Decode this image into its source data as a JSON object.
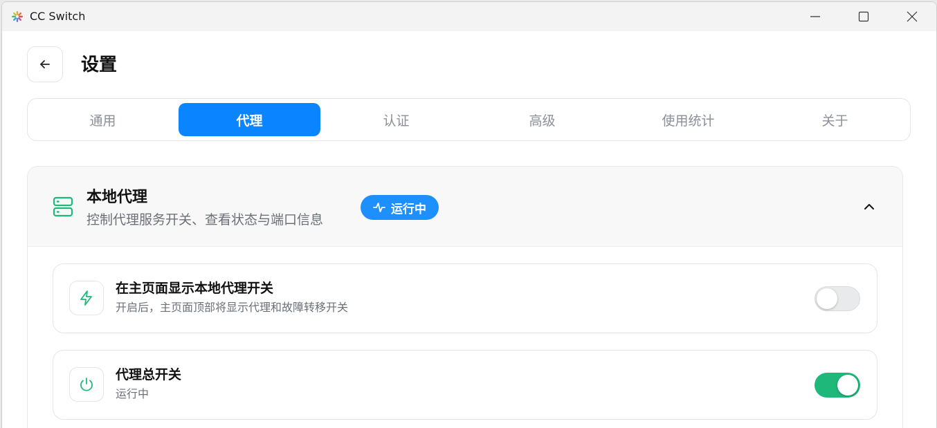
{
  "window": {
    "title": "CC Switch"
  },
  "header": {
    "page_title": "设置"
  },
  "tabs": [
    {
      "label": "通用",
      "active": false
    },
    {
      "label": "代理",
      "active": true
    },
    {
      "label": "认证",
      "active": false
    },
    {
      "label": "高级",
      "active": false
    },
    {
      "label": "使用统计",
      "active": false
    },
    {
      "label": "关于",
      "active": false
    }
  ],
  "section": {
    "title": "本地代理",
    "subtitle": "控制代理服务开关、查看状态与端口信息",
    "status_badge": "运行中",
    "rows": [
      {
        "title": "在主页面显示本地代理开关",
        "subtitle": "开启后，主页面顶部将显示代理和故障转移开关",
        "enabled": false,
        "icon": "zap-icon"
      },
      {
        "title": "代理总开关",
        "subtitle": "运行中",
        "enabled": true,
        "icon": "power-icon"
      }
    ]
  },
  "colors": {
    "accent": "#0a84ff",
    "badge": "#1e8fff",
    "success": "#1db87a"
  }
}
